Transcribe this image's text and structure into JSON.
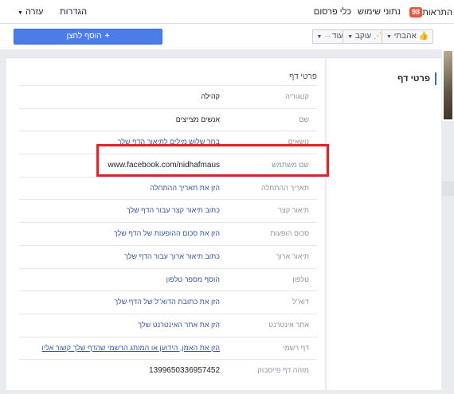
{
  "topbar": {
    "notifications_label": "התראות",
    "notifications_count": "98",
    "insights_label": "נתוני שימוש",
    "tools_label": "כלי פרסום",
    "settings_label": "הגדרות",
    "help_label": "עזרה"
  },
  "actions": {
    "add_button_label": "הוסף לחצן",
    "like_label": "אהבתי",
    "follow_label": "עוקב",
    "more_label": "עוד"
  },
  "sidebar": {
    "active_tab": "פרטי דף"
  },
  "content": {
    "section_title": "פרטי דף",
    "rows": [
      {
        "label": "קטגוריה",
        "value": "קהילה"
      },
      {
        "label": "שם",
        "value": "אנשים מצייצים"
      },
      {
        "label": "נושאים",
        "value": "בחר שלוש מילים לתיאור הדף שלך"
      },
      {
        "label": "שם משתמש",
        "value": "www.facebook.com/nidhafmaus"
      },
      {
        "label": "תאריך ההתחלה",
        "value": "הזן את תאריך ההתחלה"
      },
      {
        "label": "תיאור קצר",
        "value": "כתוב תיאור קצר עבור הדף שלך"
      },
      {
        "label": "סכום הופעות",
        "value": "הזן את סכום ההופעות של הדף שלך"
      },
      {
        "label": "תיאור ארוך",
        "value": "כתוב תיאור ארוך עבור הדף שלך"
      },
      {
        "label": "טלפון",
        "value": "הוסף מספר טלפון"
      },
      {
        "label": "דוא\"ל",
        "value": "הזן את כתובת הדוא\"ל של הדף שלך"
      },
      {
        "label": "אתר אינטרנט",
        "value": "הזן את אתר האינטרנט שלך"
      },
      {
        "label": "דף רשמי",
        "value": "הזן את האמן, הידוען או המותג הרשמי שהדף שלך קשור אליו"
      },
      {
        "label": "מזהה דף פייסבוק",
        "value": "1399650336957452"
      }
    ]
  },
  "icons": {
    "like": "thumbs-up-icon",
    "follow": "rss-icon",
    "add": "plus-icon",
    "caret": "caret-down-icon"
  },
  "colors": {
    "brand_blue": "#4267b2",
    "add_button": "#4a7ee6",
    "link": "#365899",
    "highlight": "#d9252b",
    "badge": "#e9573f"
  }
}
